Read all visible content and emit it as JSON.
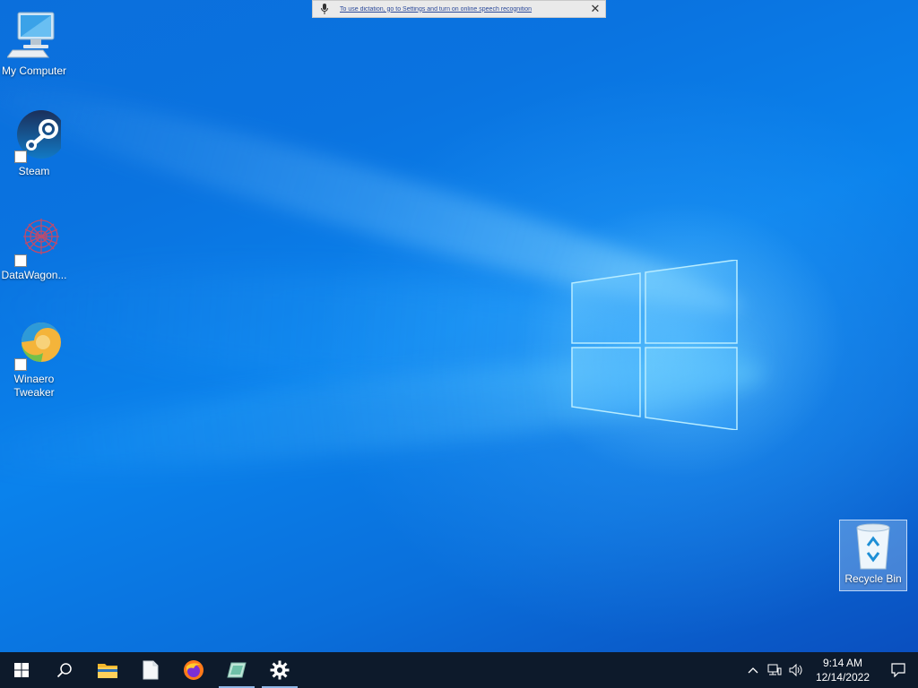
{
  "notification": {
    "message": "To use dictation, go to Settings and turn on online speech recognition",
    "icon": "microphone-icon",
    "close_icon": "close-icon"
  },
  "desktop_icons": [
    {
      "label": "My Computer",
      "icon": "computer-icon"
    },
    {
      "label": "Steam",
      "icon": "steam-icon"
    },
    {
      "label": "DataWagon...",
      "icon": "datawagon-icon"
    },
    {
      "label": "Winaero\nTweaker",
      "label_line1": "Winaero",
      "label_line2": "Tweaker",
      "icon": "winaero-tweaker-icon"
    },
    {
      "label": "Recycle Bin",
      "icon": "recycle-bin-icon"
    }
  ],
  "taskbar": {
    "pinned": [
      {
        "name": "start",
        "icon": "windows-start-icon"
      },
      {
        "name": "search",
        "icon": "search-icon"
      },
      {
        "name": "file-explorer",
        "icon": "folder-icon"
      },
      {
        "name": "notepad",
        "icon": "document-icon"
      },
      {
        "name": "firefox",
        "icon": "firefox-icon"
      },
      {
        "name": "winaero-tweaker",
        "icon": "winaero-tweaker-icon"
      },
      {
        "name": "settings",
        "icon": "gear-icon"
      }
    ],
    "tray": {
      "icons": [
        "chevron-up-icon",
        "network-icon",
        "volume-icon"
      ],
      "time": "9:14 AM",
      "date": "12/14/2022",
      "notifications_icon": "action-center-icon"
    }
  },
  "colors": {
    "desktop_accent": "#0a73e0",
    "taskbar": "#0d1a2b"
  }
}
